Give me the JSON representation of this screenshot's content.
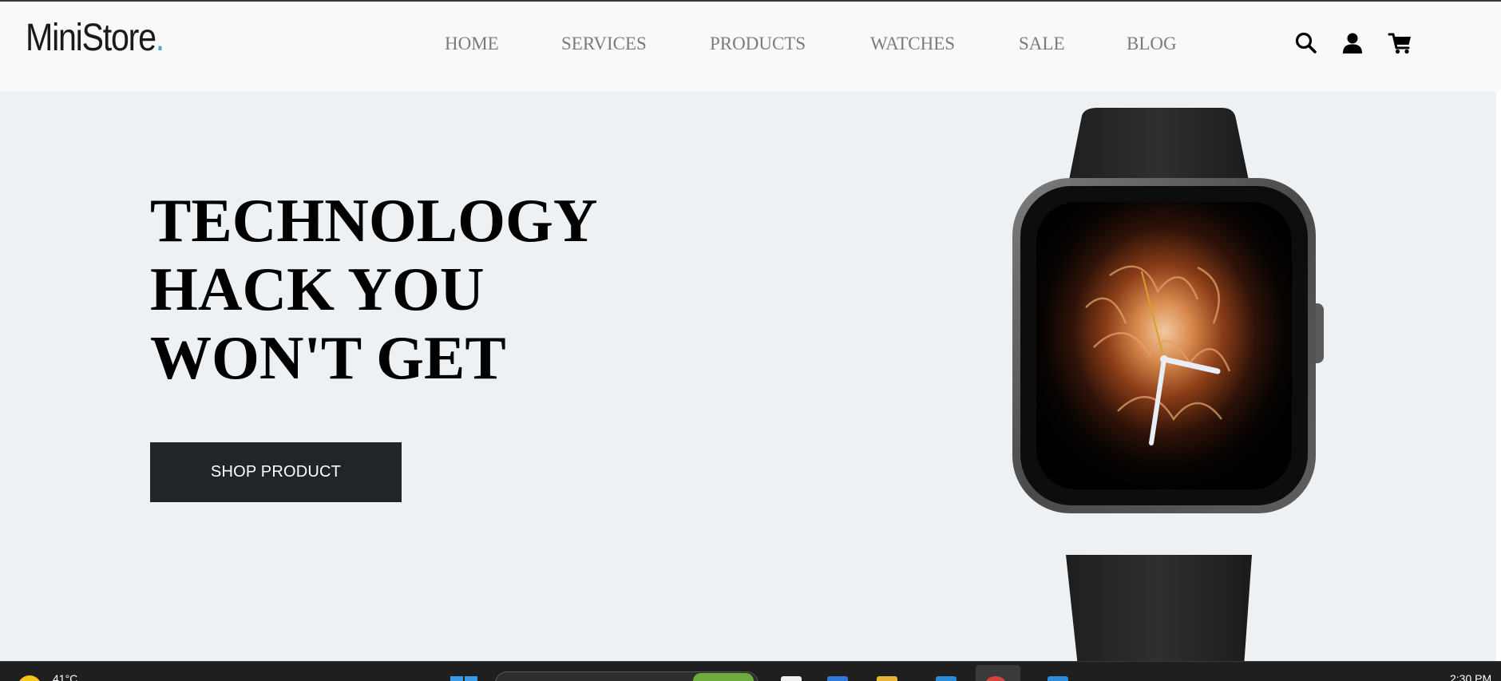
{
  "header": {
    "logo_text": "MiniStore",
    "logo_dot": ".",
    "nav": [
      {
        "label": "HOME"
      },
      {
        "label": "SERVICES"
      },
      {
        "label": "PRODUCTS"
      },
      {
        "label": "WATCHES"
      },
      {
        "label": "SALE"
      },
      {
        "label": "BLOG"
      }
    ],
    "icons": [
      "search-icon",
      "user-icon",
      "cart-icon"
    ]
  },
  "hero": {
    "headline_lines": [
      "TECHNOLOGY",
      "HACK YOU",
      "WON'T GET"
    ],
    "cta_label": "SHOP PRODUCT"
  },
  "taskbar": {
    "temperature": "41°C",
    "time": "2:30 PM"
  },
  "colors": {
    "accent": "#49a6c8",
    "button_bg": "#212529",
    "hero_bg": "#edf1f4",
    "header_bg": "#f8f9fa",
    "nav_text": "#7b7b7b"
  }
}
